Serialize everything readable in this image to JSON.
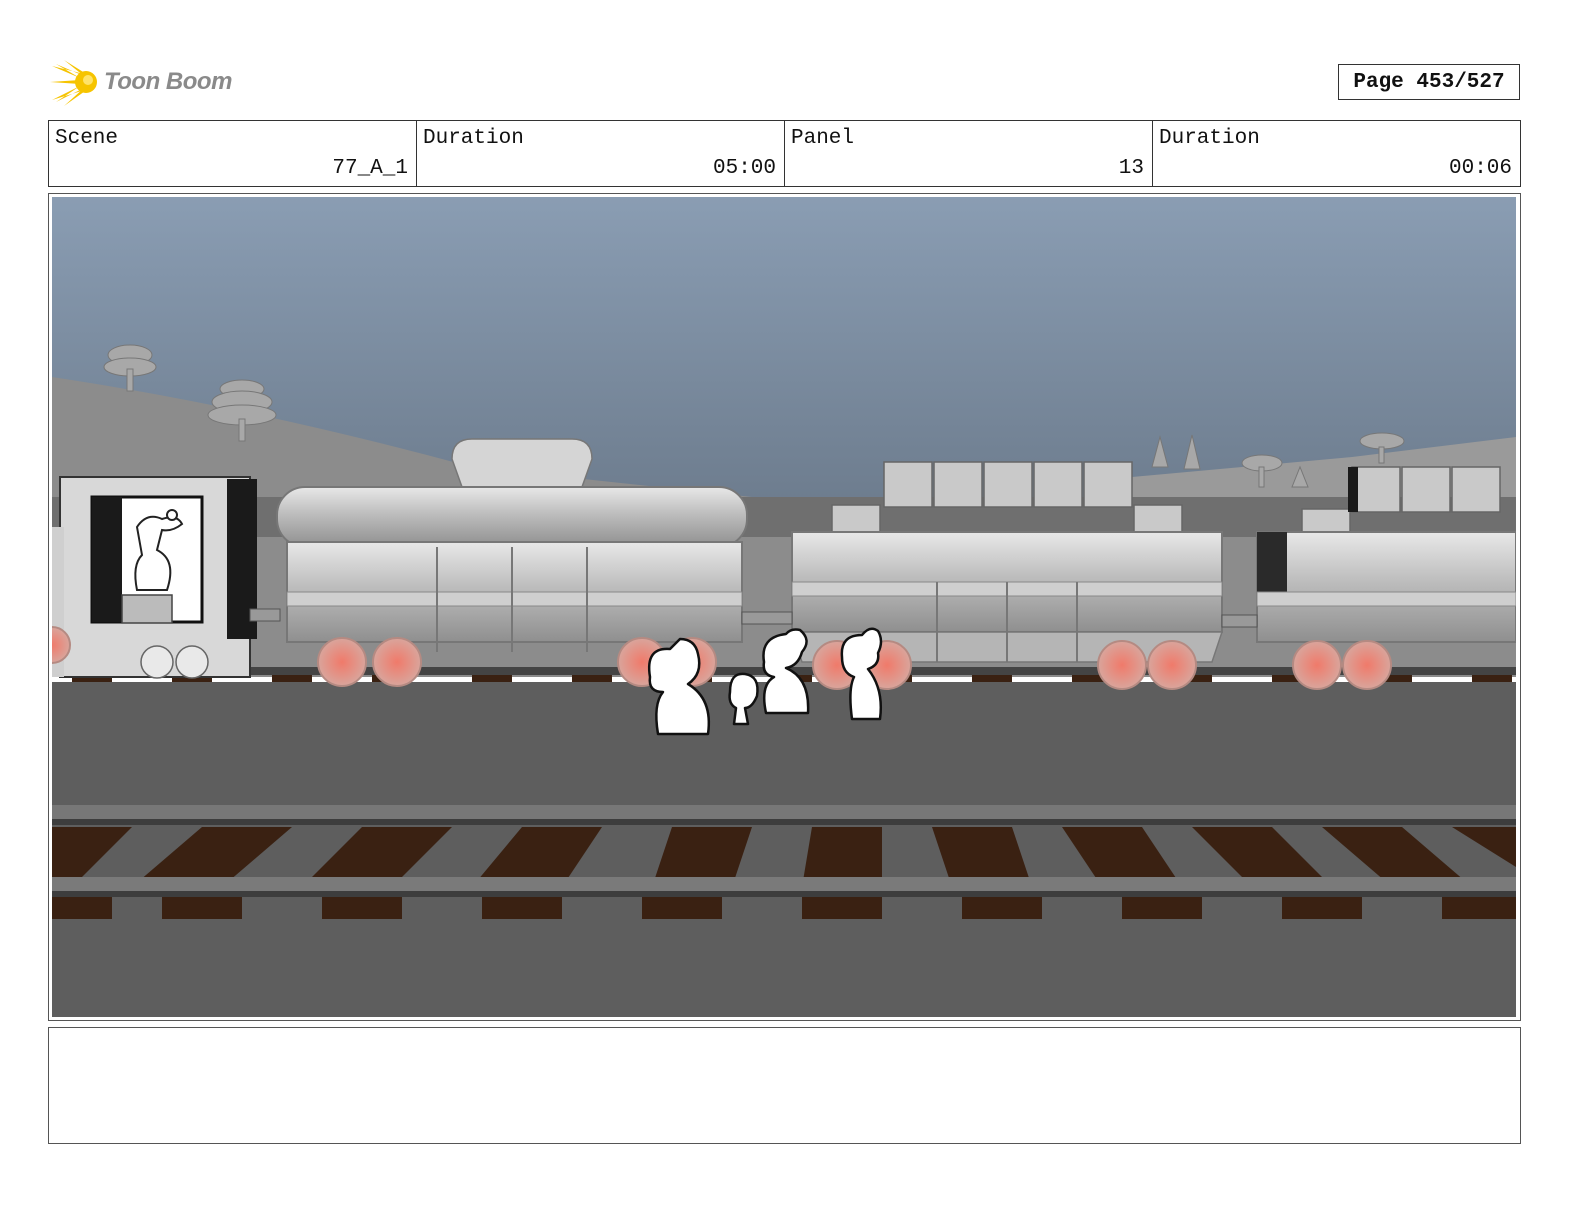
{
  "header": {
    "logo_text": "Toon Boom",
    "page_label": "Page 453/527"
  },
  "panel_info": {
    "scene_label": "Scene",
    "scene_value": "77_A_1",
    "scene_duration_label": "Duration",
    "scene_duration_value": "05:00",
    "panel_label": "Panel",
    "panel_value": "13",
    "panel_duration_label": "Duration",
    "panel_duration_value": "00:06"
  },
  "notes": {
    "text": ""
  },
  "colors": {
    "logo_accent": "#f6c400",
    "sky_top": "#8a9db3",
    "sky_bottom": "#5d6a79",
    "ground": "#5e5e5e",
    "tie_brown": "#3a2112",
    "wheel_glow": "#e36b5c"
  },
  "icons": {
    "logo": "toon-boom-comet-icon"
  }
}
